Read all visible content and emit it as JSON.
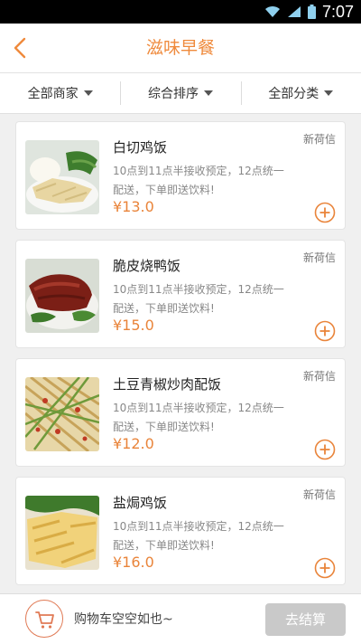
{
  "status_bar": {
    "time": "7:07"
  },
  "header": {
    "title": "滋味早餐",
    "back_icon": "chevron-left-icon"
  },
  "filters": [
    {
      "label": "全部商家"
    },
    {
      "label": "综合排序"
    },
    {
      "label": "全部分类"
    }
  ],
  "items": [
    {
      "name": "白切鸡饭",
      "merchant": "新荷信",
      "desc_line1": "10点到11点半接收预定，12点统一",
      "desc_line2": "配送，下单即送饮料!",
      "price": "¥13.0"
    },
    {
      "name": "脆皮烧鸭饭",
      "merchant": "新荷信",
      "desc_line1": "10点到11点半接收预定，12点统一",
      "desc_line2": "配送，下单即送饮料!",
      "price": "¥15.0"
    },
    {
      "name": "土豆青椒炒肉配饭",
      "merchant": "新荷信",
      "desc_line1": "10点到11点半接收预定，12点统一",
      "desc_line2": "配送，下单即送饮料!",
      "price": "¥12.0"
    },
    {
      "name": "盐焗鸡饭",
      "merchant": "新荷信",
      "desc_line1": "10点到11点半接收预定，12点统一",
      "desc_line2": "配送，下单即送饮料!",
      "price": "¥16.0"
    }
  ],
  "cart": {
    "empty_text": "购物车空空如也~",
    "checkout_label": "去结算"
  },
  "colors": {
    "accent": "#ef8a3c",
    "price": "#e9843a",
    "checkout_disabled": "#c9c9c9"
  }
}
